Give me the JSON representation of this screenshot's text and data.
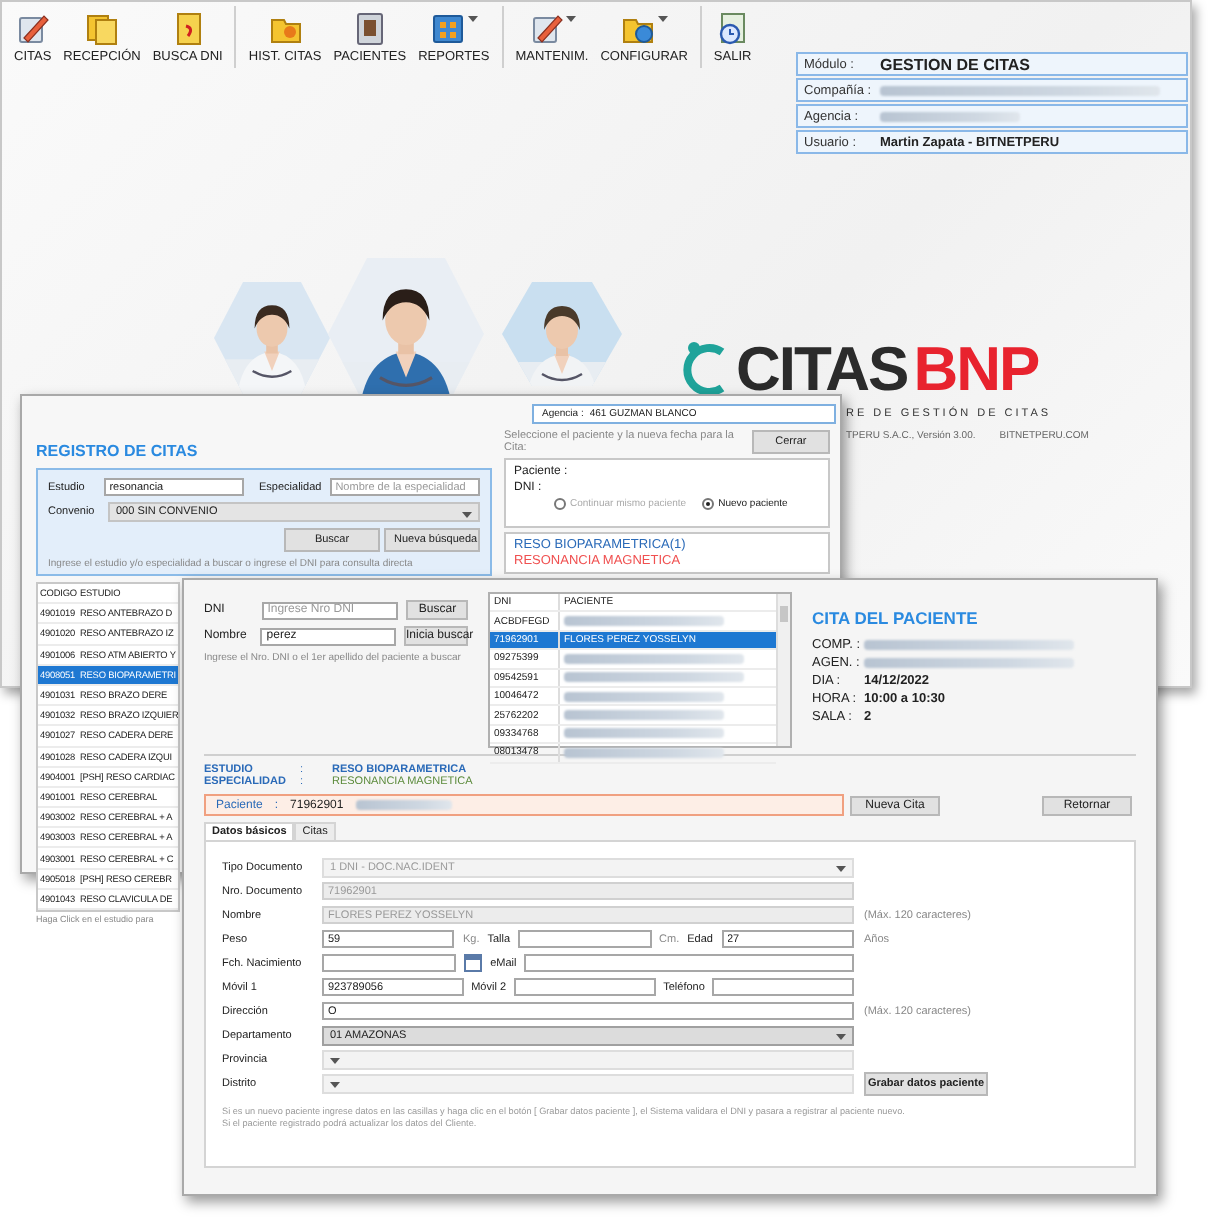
{
  "main_window": {
    "toolbar": [
      [
        {
          "label": "CITAS",
          "menu": false
        },
        {
          "label": "RECEPCIÓN",
          "menu": false
        },
        {
          "label": "BUSCA DNI",
          "menu": false
        }
      ],
      [
        {
          "label": "HIST. CITAS",
          "menu": false
        },
        {
          "label": "PACIENTES",
          "menu": false
        },
        {
          "label": "REPORTES",
          "menu": true
        }
      ],
      [
        {
          "label": "MANTENIM.",
          "menu": true
        },
        {
          "label": "CONFIGURAR",
          "menu": true
        }
      ],
      [
        {
          "label": "SALIR",
          "menu": false
        }
      ]
    ],
    "session": [
      {
        "label": "Módulo :",
        "value": "GESTION DE CITAS",
        "redacted": false
      },
      {
        "label": "Compañía :",
        "redacted": true
      },
      {
        "label": "Agencia :",
        "redacted": true
      },
      {
        "label": "Usuario :",
        "value": "Martin Zapata - BITNETPERU",
        "redacted": false
      }
    ],
    "logo": {
      "name": "CITAS",
      "accent": "BNP",
      "tagline": "RE DE GESTIÓN DE CITAS",
      "version": "TPERU S.A.C., Versión 3.00.",
      "site": "BITNETPERU.COM"
    }
  },
  "registro": {
    "agency": {
      "label": "Agencia :",
      "value": "461 GUZMAN BLANCO"
    },
    "title": "REGISTRO DE CITAS",
    "search": {
      "estudio": {
        "label": "Estudio",
        "value": "resonancia"
      },
      "especialidad": {
        "label": "Especialidad",
        "placeholder": "Nombre de la especialidad"
      },
      "convenio": {
        "label": "Convenio",
        "value": "000 SIN CONVENIO"
      },
      "buttons": [
        "Buscar",
        "Nueva búsqueda"
      ],
      "hint": "Ingrese el estudio y/o especialidad a buscar  o  ingrese el DNI para consulta directa"
    },
    "instruction": "Seleccione el paciente y la nueva fecha para la Cita:",
    "close_button": "Cerrar",
    "patient": {
      "paciente_label": "Paciente :",
      "dni_label": "DNI :",
      "options": [
        {
          "label": "Continuar mismo paciente",
          "selected": false,
          "disabled": true
        },
        {
          "label": "Nuevo paciente",
          "selected": true,
          "disabled": false
        }
      ]
    },
    "selection": {
      "study": "RESO BIOPARAMETRICA(1)",
      "specialty": "RESONANCIA MAGNETICA"
    },
    "table": {
      "columns": [
        "CODIGO",
        "ESTUDIO"
      ],
      "rows": [
        {
          "cells": [
            "4901019",
            "RESO ANTEBRAZO D"
          ],
          "selected": false
        },
        {
          "cells": [
            "4901020",
            "RESO ANTEBRAZO IZ"
          ],
          "selected": false
        },
        {
          "cells": [
            "4901006",
            "RESO ATM ABIERTO Y"
          ],
          "selected": false
        },
        {
          "cells": [
            "4908051",
            "RESO BIOPARAMETRI"
          ],
          "selected": true
        },
        {
          "cells": [
            "4901031",
            "RESO BRAZO DERE"
          ],
          "selected": false
        },
        {
          "cells": [
            "4901032",
            "RESO BRAZO IZQUIER"
          ],
          "selected": false
        },
        {
          "cells": [
            "4901027",
            "RESO CADERA DERE"
          ],
          "selected": false
        },
        {
          "cells": [
            "4901028",
            "RESO CADERA IZQUI"
          ],
          "selected": false
        },
        {
          "cells": [
            "4904001",
            "[PSH] RESO CARDIAC"
          ],
          "selected": false
        },
        {
          "cells": [
            "4901001",
            "RESO CEREBRAL"
          ],
          "selected": false
        },
        {
          "cells": [
            "4903002",
            "RESO CEREBRAL + A"
          ],
          "selected": false
        },
        {
          "cells": [
            "4903003",
            "RESO CEREBRAL + A"
          ],
          "selected": false
        },
        {
          "cells": [
            "4903001",
            "RESO CEREBRAL + C"
          ],
          "selected": false
        },
        {
          "cells": [
            "4905018",
            "[PSH] RESO CEREBR"
          ],
          "selected": false
        },
        {
          "cells": [
            "4901043",
            "RESO CLAVICULA DE"
          ],
          "selected": false
        }
      ],
      "footer": "Haga Click en el estudio para"
    }
  },
  "cita": {
    "dni": {
      "label": "DNI",
      "placeholder": "Ingrese Nro DNI"
    },
    "nombre": {
      "label": "Nombre",
      "value": "perez"
    },
    "buttons": [
      "Buscar",
      "Inicia buscar"
    ],
    "hint": "Ingrese el Nro. DNI o el 1er apellido del paciente a buscar",
    "patients": {
      "columns": [
        "DNI",
        "PACIENTE"
      ],
      "rows": [
        {
          "dni": "ACBDFEGD",
          "redacted": true,
          "selected": false
        },
        {
          "dni": "71962901",
          "name": "FLORES PEREZ YOSSELYN",
          "redacted": false,
          "selected": true
        },
        {
          "dni": "09275399",
          "redacted": true,
          "selected": false
        },
        {
          "dni": "09542591",
          "redacted": true,
          "selected": false
        },
        {
          "dni": "10046472",
          "redacted": true,
          "selected": false
        },
        {
          "dni": "25762202",
          "redacted": true,
          "selected": false
        },
        {
          "dni": "09334768",
          "redacted": true,
          "selected": false
        },
        {
          "dni": "08013478",
          "redacted": true,
          "selected": false
        }
      ]
    },
    "appointment": {
      "title": "CITA DEL PACIENTE",
      "rows": [
        {
          "label": "COMP. :",
          "redacted": true
        },
        {
          "label": "AGEN. :",
          "redacted": true
        },
        {
          "label": "DIA :",
          "value": "14/12/2022",
          "redacted": false
        },
        {
          "label": "HORA :",
          "value": "10:00 a 10:30",
          "redacted": false
        },
        {
          "label": "SALA :",
          "value": "2",
          "redacted": false
        }
      ]
    },
    "study": [
      {
        "kind": "study",
        "label": "ESTUDIO",
        "colon": ":",
        "value": "RESO BIOPARAMETRICA"
      },
      {
        "kind": "specialty",
        "label": "ESPECIALIDAD",
        "colon": ":",
        "value": "RESONANCIA MAGNETICA"
      }
    ],
    "patient_bar": {
      "label": "Paciente",
      "colon": ":",
      "value": "71962901",
      "redacted": true
    },
    "new_button": "Nueva Cita",
    "back_button": "Retornar",
    "tabs": [
      {
        "label": "Datos básicos",
        "selected": true
      },
      {
        "label": "Citas",
        "selected": false
      }
    ],
    "form": {
      "rows": [
        {
          "items": [
            {
              "kind": "label",
              "text": "Tipo Documento"
            },
            {
              "kind": "select",
              "value": "1 DNI - DOC.NAC.IDENT",
              "disabled": true
            }
          ]
        },
        {
          "items": [
            {
              "kind": "label",
              "text": "Nro. Documento"
            },
            {
              "kind": "input",
              "value": "71962901",
              "disabled": true
            }
          ]
        },
        {
          "items": [
            {
              "kind": "label",
              "text": "Nombre"
            },
            {
              "kind": "input",
              "value": "FLORES PEREZ YOSSELYN",
              "disabled": true
            }
          ],
          "note": "(Máx. 120 caracteres)"
        },
        {
          "items": [
            {
              "kind": "label",
              "text": "Peso"
            },
            {
              "kind": "input",
              "value": "59",
              "disabled": false
            },
            {
              "kind": "unit",
              "text": "Kg."
            },
            {
              "kind": "label",
              "text": "Talla"
            },
            {
              "kind": "input",
              "disabled": false
            },
            {
              "kind": "unit",
              "text": "Cm."
            },
            {
              "kind": "label",
              "text": "Edad"
            },
            {
              "kind": "input",
              "value": "27",
              "disabled": false
            }
          ],
          "note": "Años"
        },
        {
          "items": [
            {
              "kind": "label",
              "text": "Fch. Nacimiento"
            },
            {
              "kind": "input",
              "disabled": false
            },
            {
              "kind": "calendar"
            },
            {
              "kind": "label",
              "text": "eMail"
            },
            {
              "kind": "input",
              "disabled": false,
              "wide": true
            }
          ]
        },
        {
          "items": [
            {
              "kind": "label",
              "text": "Móvil 1"
            },
            {
              "kind": "input",
              "value": "923789056",
              "disabled": false
            },
            {
              "kind": "label",
              "text": "Móvil 2"
            },
            {
              "kind": "input",
              "disabled": false
            },
            {
              "kind": "label",
              "text": "Teléfono"
            },
            {
              "kind": "input",
              "disabled": false
            }
          ]
        },
        {
          "items": [
            {
              "kind": "label",
              "text": "Dirección"
            },
            {
              "kind": "input",
              "value": "O",
              "disabled": false
            }
          ],
          "note": "(Máx. 120 caracteres)"
        },
        {
          "items": [
            {
              "kind": "label",
              "text": "Departamento"
            },
            {
              "kind": "select",
              "value": "01 AMAZONAS",
              "disabled": false
            }
          ]
        },
        {
          "items": [
            {
              "kind": "label",
              "text": "Provincia"
            },
            {
              "kind": "select",
              "disabled": true
            }
          ]
        },
        {
          "items": [
            {
              "kind": "label",
              "text": "Distrito"
            },
            {
              "kind": "select",
              "disabled": true
            }
          ],
          "action": "Grabar datos paciente"
        }
      ],
      "note": [
        "Si es un nuevo paciente ingrese datos en las casillas y haga clic en el botón [ Grabar datos paciente ], el Sistema validara el DNI y pasara a registrar al paciente nuevo.",
        "Si el paciente registrado podrá actualizar los datos del Cliente."
      ]
    }
  }
}
